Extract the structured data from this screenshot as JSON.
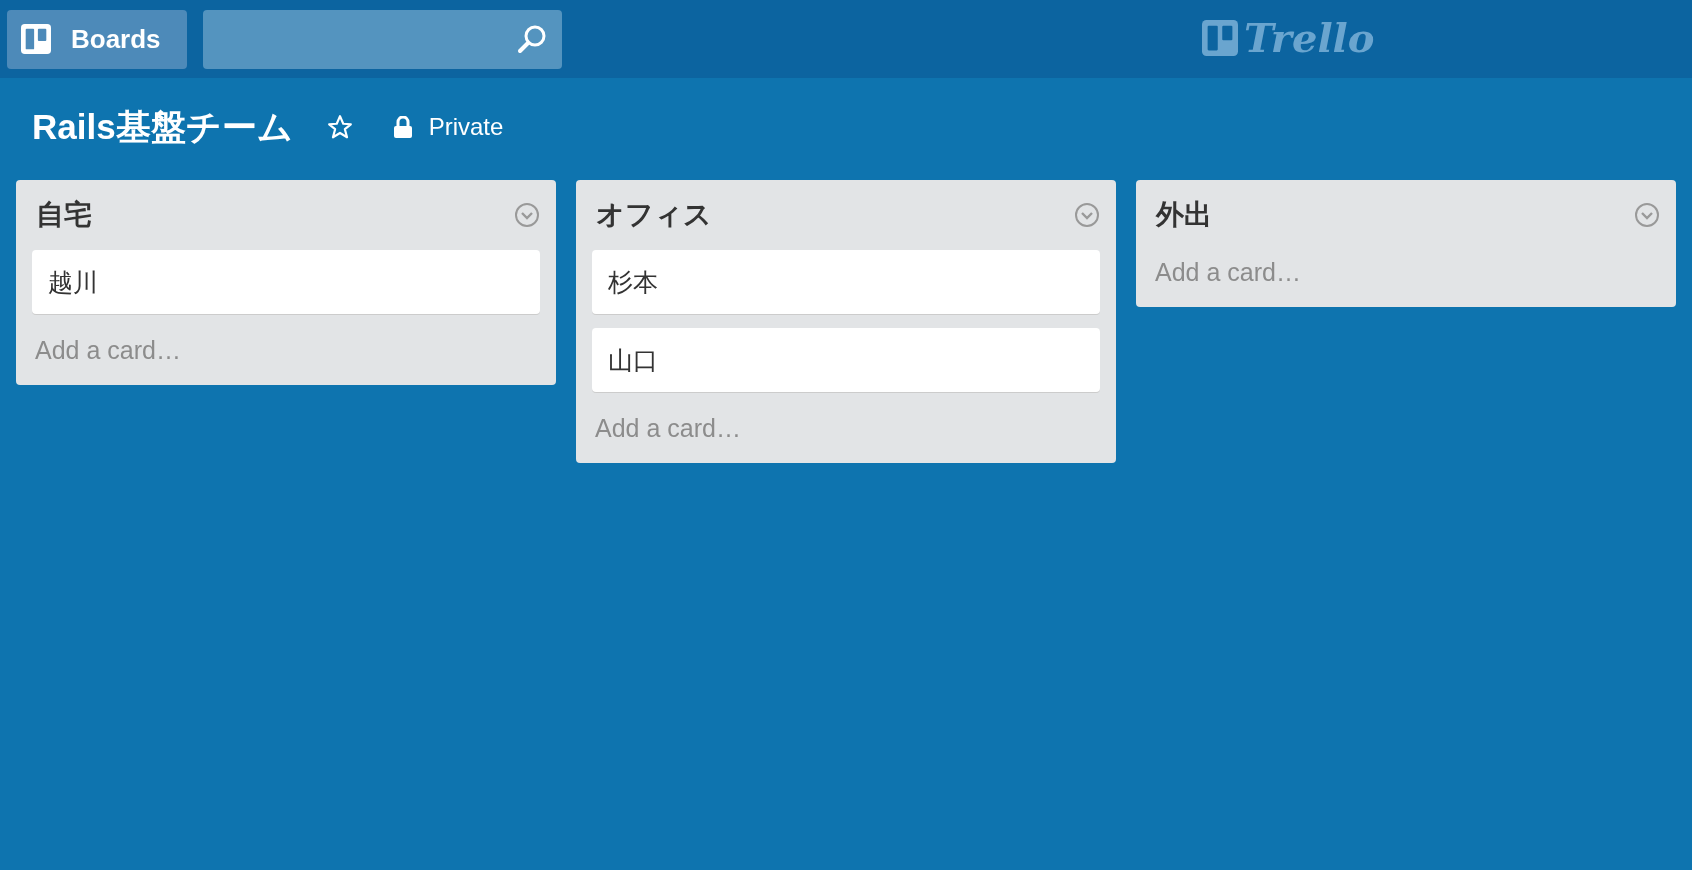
{
  "header": {
    "boards_button": "Boards",
    "logo": "Trello"
  },
  "board": {
    "title": "Rails基盤チーム",
    "starred": false,
    "visibility": "Private"
  },
  "lists": [
    {
      "title": "自宅",
      "cards": [
        "越川"
      ],
      "add_card": "Add a card…"
    },
    {
      "title": "オフィス",
      "cards": [
        "杉本",
        "山口"
      ],
      "add_card": "Add a card…"
    },
    {
      "title": "外出",
      "add_card": "Add a card…"
    }
  ]
}
